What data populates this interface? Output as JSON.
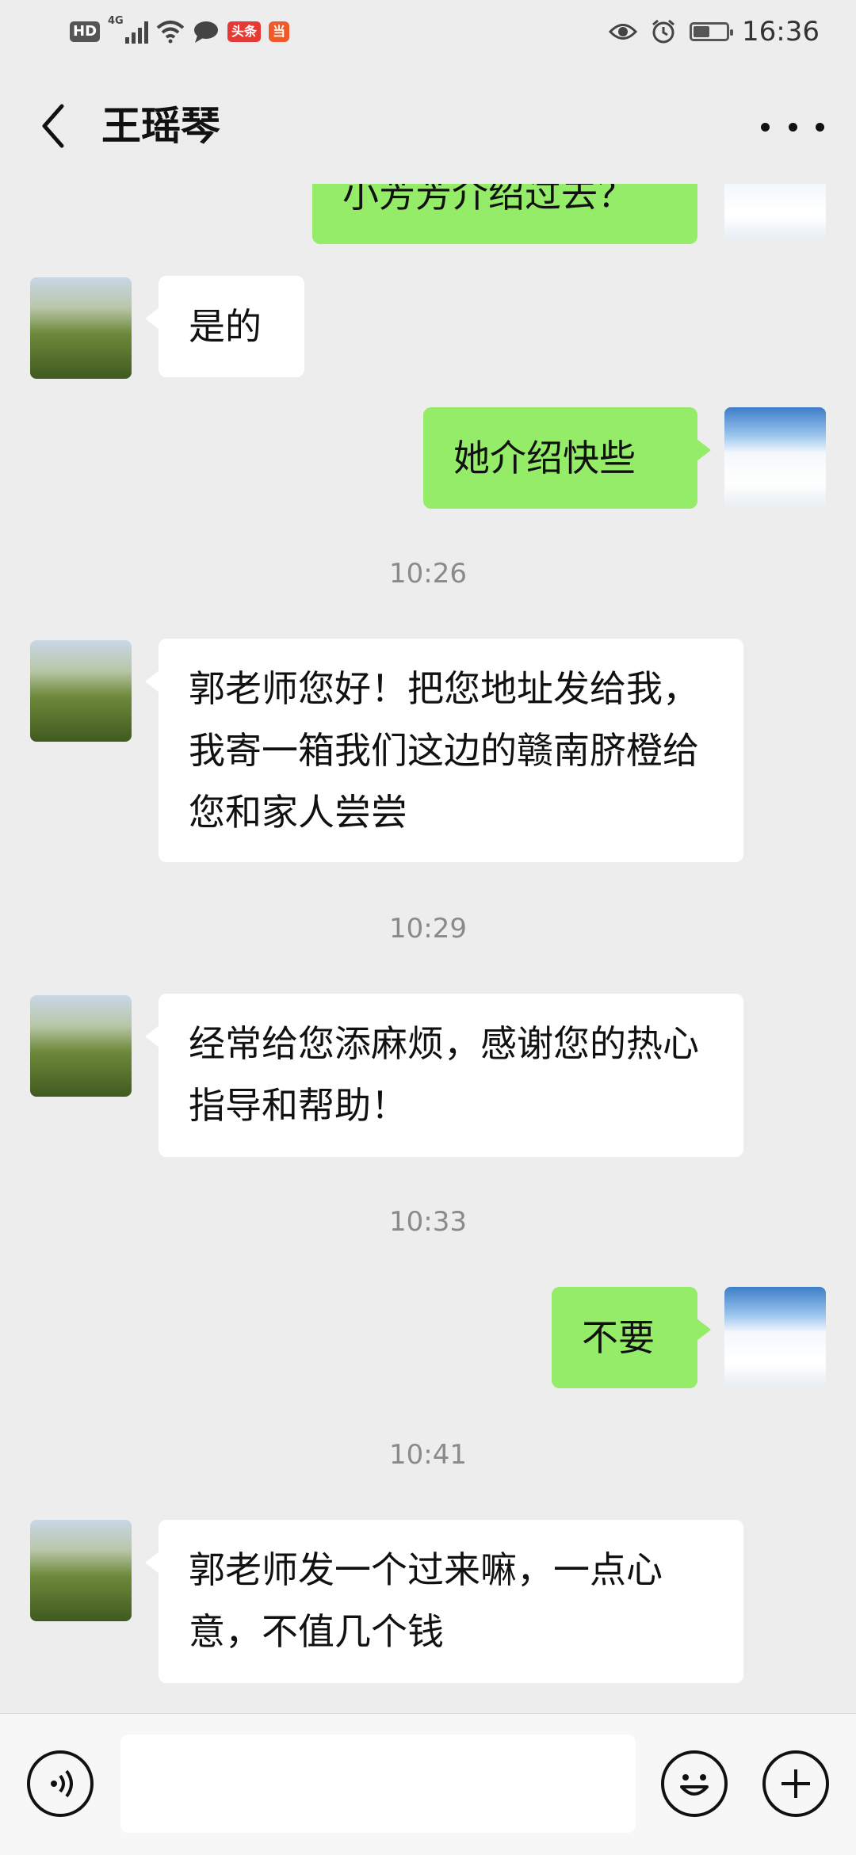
{
  "status_bar": {
    "left_icons": [
      "hd-icon",
      "signal-4g-icon",
      "wifi-icon",
      "message-icon",
      "toutiao-icon",
      "dangdang-icon"
    ],
    "hd_label": "HD",
    "network_label": "4G",
    "toutiao_label": "头条",
    "dangdang_label": "当",
    "time": "16:36",
    "battery_level": 0.5
  },
  "header": {
    "title": "王瑶琴"
  },
  "messages": [
    {
      "side": "right",
      "text": "小芳芳介绍过去？"
    },
    {
      "side": "left",
      "text": "是的"
    },
    {
      "side": "right",
      "text": "她介绍快些"
    },
    {
      "type": "time",
      "text": "10:26"
    },
    {
      "side": "left",
      "text": "郭老师您好！把您地址发给我，我寄一箱我们这边的赣南脐橙给您和家人尝尝"
    },
    {
      "type": "time",
      "text": "10:29"
    },
    {
      "side": "left",
      "text": "经常给您添麻烦，感谢您的热心指导和帮助！"
    },
    {
      "type": "time",
      "text": "10:33"
    },
    {
      "side": "right",
      "text": "不要"
    },
    {
      "type": "time",
      "text": "10:41"
    },
    {
      "side": "left",
      "text": "郭老师发一个过来嘛，一点心意，不值几个钱"
    }
  ],
  "input": {
    "value": ""
  },
  "colors": {
    "background": "#ededed",
    "bubble_self": "#95ec69",
    "bubble_other": "#ffffff",
    "timestamp": "#8a8a8a"
  }
}
